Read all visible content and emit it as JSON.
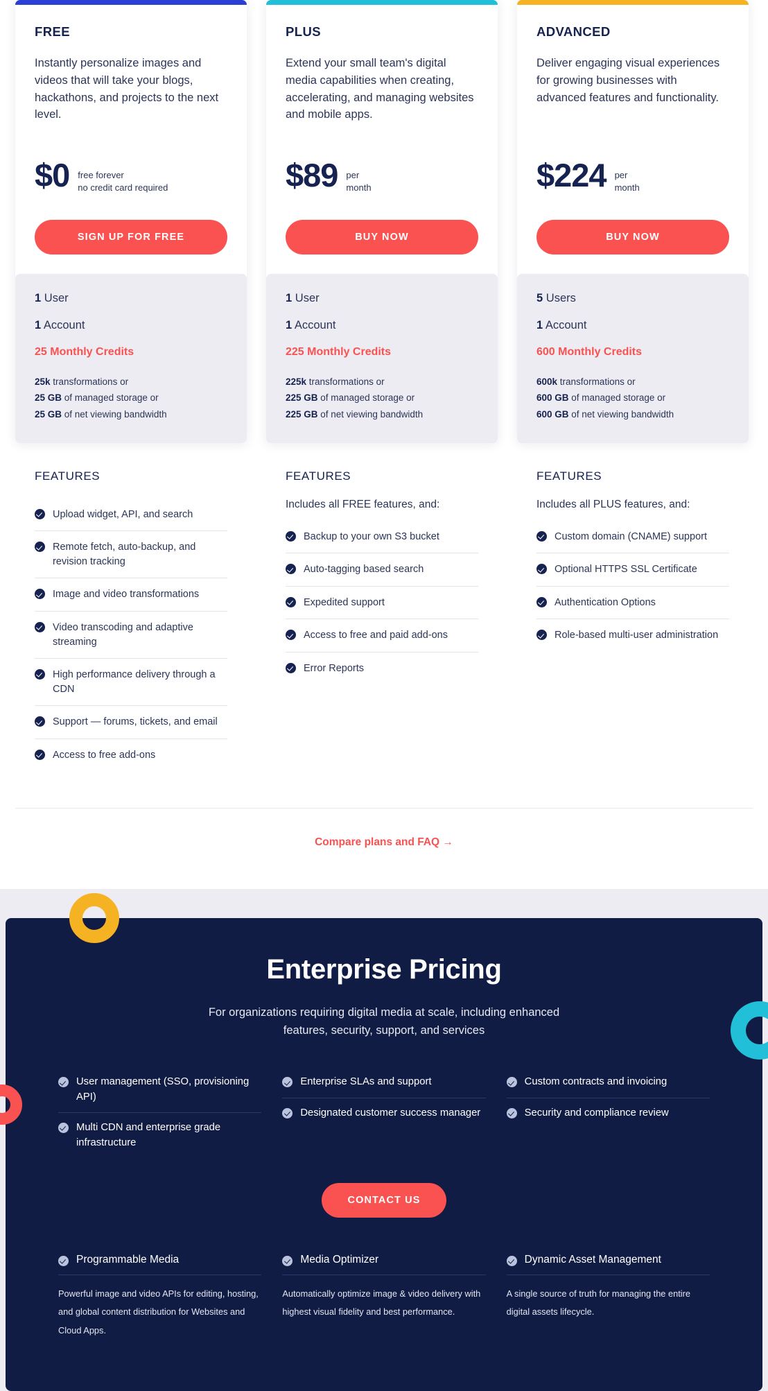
{
  "plans": [
    {
      "accent_color": "#2b3fd4",
      "name": "FREE",
      "description": "Instantly personalize images and videos that will take your blogs, hackathons, and projects to the next level.",
      "price": "$0",
      "price_note": "free forever\nno credit card required",
      "cta_label": "SIGN UP FOR FREE",
      "users": "1",
      "users_label": "User",
      "accounts": "1",
      "accounts_label": "Account",
      "credits": "25 Monthly Credits",
      "detail": [
        {
          "value": "25k",
          "text": " transformations or"
        },
        {
          "value": "25 GB",
          "text": " of managed storage or"
        },
        {
          "value": "25 GB",
          "text": " of net viewing bandwidth"
        }
      ],
      "features_title": "FEATURES",
      "features_intro": "",
      "features": [
        "Upload widget, API, and search",
        "Remote fetch, auto-backup, and revision tracking",
        "Image and video transformations",
        "Video transcoding and adaptive streaming",
        "High performance delivery through a CDN",
        "Support — forums, tickets, and email",
        "Access to free add-ons"
      ]
    },
    {
      "accent_color": "#22c0d8",
      "name": "PLUS",
      "description": "Extend your small team's digital media capabilities when creating, accelerating, and managing websites and mobile apps.",
      "price": "$89",
      "price_note": "per\nmonth",
      "cta_label": "BUY NOW",
      "users": "1",
      "users_label": "User",
      "accounts": "1",
      "accounts_label": "Account",
      "credits": "225 Monthly Credits",
      "detail": [
        {
          "value": "225k",
          "text": " transformations or"
        },
        {
          "value": "225 GB",
          "text": " of managed storage or"
        },
        {
          "value": "225 GB",
          "text": " of net viewing bandwidth"
        }
      ],
      "features_title": "FEATURES",
      "features_intro": "Includes all FREE features, and:",
      "features": [
        "Backup to your own S3 bucket",
        "Auto-tagging based search",
        "Expedited support",
        "Access to free and paid add-ons",
        "Error Reports"
      ]
    },
    {
      "accent_color": "#f5b223",
      "name": "ADVANCED",
      "description": "Deliver engaging visual experiences for growing businesses with advanced features and functionality.",
      "price": "$224",
      "price_note": "per\nmonth",
      "cta_label": "BUY NOW",
      "users": "5",
      "users_label": "Users",
      "accounts": "1",
      "accounts_label": "Account",
      "credits": "600 Monthly Credits",
      "detail": [
        {
          "value": "600k",
          "text": " transformations or"
        },
        {
          "value": "600 GB",
          "text": " of managed storage or"
        },
        {
          "value": "600 GB",
          "text": " of net viewing bandwidth"
        }
      ],
      "features_title": "FEATURES",
      "features_intro": "Includes all PLUS features, and:",
      "features": [
        "Custom domain (CNAME) support",
        "Optional HTTPS SSL Certificate",
        "Authentication Options",
        "Role-based multi-user administration"
      ]
    }
  ],
  "compare": {
    "label": "Compare plans and FAQ →",
    "color": "#fa5151"
  },
  "enterprise": {
    "title": "Enterprise Pricing",
    "subtitle": "For organizations requiring digital media at scale, including enhanced features, security, support, and services",
    "feature_columns": [
      [
        "User management (SSO, provisioning API)",
        "Multi CDN and enterprise grade infrastructure"
      ],
      [
        "Enterprise SLAs and support",
        "Designated customer success manager"
      ],
      [
        "Custom contracts and invoicing",
        "Security and compliance review"
      ]
    ],
    "contact_label": "CONTACT US",
    "products": [
      {
        "title": "Programmable Media",
        "description": "Powerful image and video APIs for editing, hosting, and global content distribution for Websites and Cloud Apps."
      },
      {
        "title": "Media Optimizer",
        "description": "Automatically optimize image & video delivery with highest visual fidelity and best performance."
      },
      {
        "title": "Dynamic Asset Management",
        "description": "A single source of truth for managing the entire digital assets lifecycle."
      }
    ],
    "background_color": "#101c44",
    "decorations": [
      "yellow-donut",
      "cyan-donut",
      "red-donut"
    ]
  }
}
